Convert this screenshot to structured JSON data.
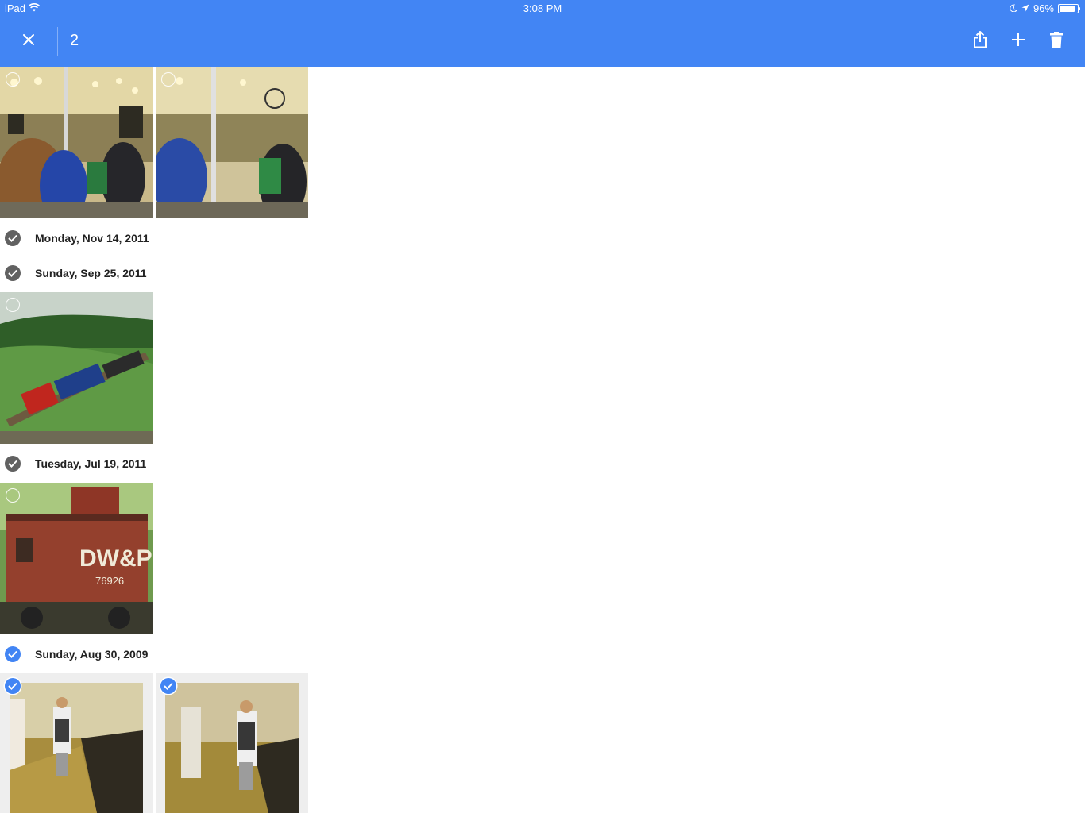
{
  "status_bar": {
    "device": "iPad",
    "time": "3:08 PM",
    "battery": "96%",
    "battery_level": 0.96
  },
  "toolbar": {
    "selected_count": "2",
    "icons": [
      "close-icon",
      "share-icon",
      "add-icon",
      "delete-icon"
    ]
  },
  "groups": [
    {
      "label": "Monday, Nov 14, 2011",
      "selected": false
    },
    {
      "label": "Sunday, Sep 25, 2011",
      "selected": false
    },
    {
      "label": "Tuesday, Jul 19, 2011",
      "selected": false
    },
    {
      "label": "Sunday, Aug 30, 2009",
      "selected": true
    }
  ],
  "photos": [
    {
      "subject": "train interior crowd",
      "selected": false
    },
    {
      "subject": "train interior crowd 2",
      "selected": false
    },
    {
      "subject": "locomotive on green hillside",
      "selected": false
    },
    {
      "subject": "red caboose DW&P 76926",
      "selected": false,
      "caption_on_image": "DW&P 76926"
    },
    {
      "subject": "man on subway platform",
      "selected": true
    },
    {
      "subject": "man on subway platform 2",
      "selected": true
    }
  ],
  "colors": {
    "accent": "#4285f4",
    "check_gray": "#616161"
  }
}
